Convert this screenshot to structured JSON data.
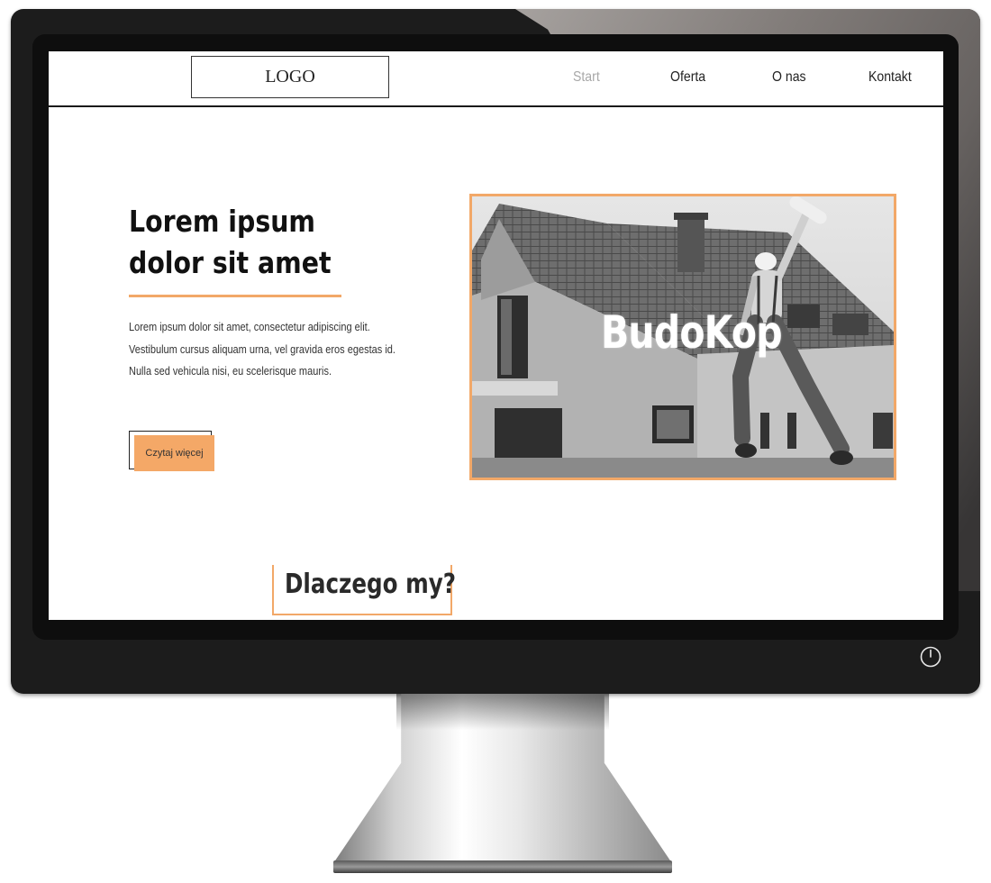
{
  "nav": {
    "logo": "LOGO",
    "items": [
      {
        "label": "Start",
        "active": true
      },
      {
        "label": "Oferta",
        "active": false
      },
      {
        "label": "O nas",
        "active": false
      },
      {
        "label": "Kontakt",
        "active": false
      }
    ]
  },
  "hero": {
    "title_line1": "Lorem ipsum",
    "title_line2": "dolor sit amet",
    "body": "Lorem ipsum dolor sit amet, consectetur adipiscing elit. Vestibulum cursus aliquam urna, vel gravida eros egestas id. Nulla sed vehicula nisi, eu scelerisque mauris.",
    "cta_label": "Czytaj więcej",
    "image_brand": "BudoKop"
  },
  "section": {
    "heading": "Dlaczego my?"
  },
  "colors": {
    "accent": "#f4a867",
    "nav_active": "#a8a8a8",
    "frame": "#1c1c1c"
  },
  "icons": {
    "power": "power-icon"
  }
}
